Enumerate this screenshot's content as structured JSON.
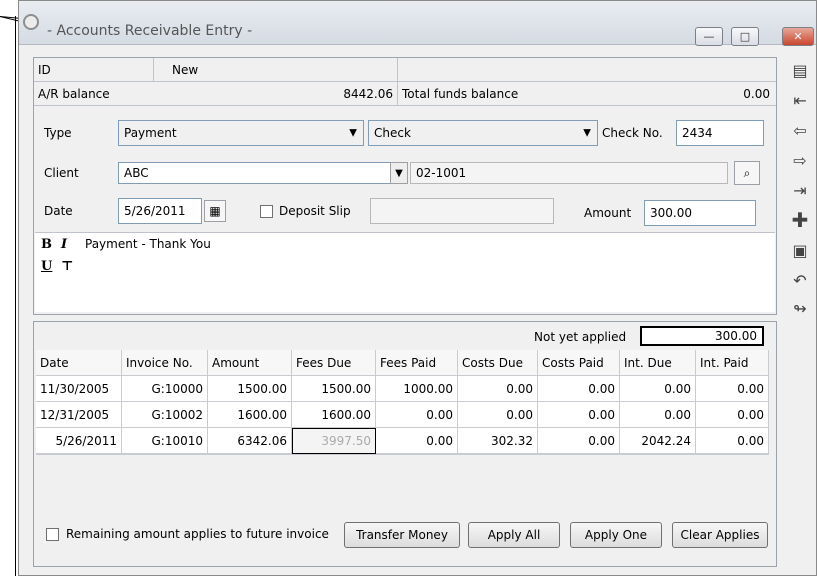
{
  "window": {
    "title": "- Accounts Receivable Entry -",
    "minimize_glyph": "—",
    "maximize_glyph": "□",
    "close_glyph": "✕"
  },
  "header": {
    "id_label": "ID",
    "id_value": "New",
    "ar_balance_label": "A/R balance",
    "ar_balance_value": "8442.06",
    "total_funds_label": "Total funds balance",
    "total_funds_value": "0.00"
  },
  "form": {
    "type_label": "Type",
    "type_value": "Payment",
    "method_value": "Check",
    "check_no_label": "Check No.",
    "check_no_value": "2434",
    "client_label": "Client",
    "client_value": "ABC",
    "client_code": "02-1001",
    "date_label": "Date",
    "date_value": "5/26/2011",
    "deposit_slip_label": "Deposit Slip",
    "deposit_slip_value": "",
    "amount_label": "Amount",
    "amount_value": "300.00",
    "memo": "Payment - Thank You"
  },
  "apply": {
    "not_yet_applied_label": "Not yet applied",
    "not_yet_applied_value": "300.00",
    "columns": [
      "Date",
      "Invoice No.",
      "Amount",
      "Fees Due",
      "Fees Paid",
      "Costs Due",
      "Costs Paid",
      "Int. Due",
      "Int. Paid"
    ],
    "rows": [
      [
        "11/30/2005",
        "G:10000",
        "1500.00",
        "1500.00",
        "1000.00",
        "0.00",
        "0.00",
        "0.00",
        "0.00"
      ],
      [
        "12/31/2005",
        "G:10002",
        "1600.00",
        "1600.00",
        "0.00",
        "0.00",
        "0.00",
        "0.00",
        "0.00"
      ],
      [
        "5/26/2011",
        "G:10010",
        "6342.06",
        "3997.50",
        "0.00",
        "302.32",
        "0.00",
        "2042.24",
        "0.00"
      ]
    ],
    "remaining_label": "Remaining amount applies to future invoice",
    "buttons": {
      "transfer": "Transfer Money",
      "apply_all": "Apply All",
      "apply_one": "Apply One",
      "clear": "Clear Applies"
    }
  },
  "toolbar_icons": [
    "document-icon",
    "first-record-icon",
    "previous-record-icon",
    "next-record-icon",
    "last-record-icon",
    "add-icon",
    "save-icon",
    "undo-icon",
    "exit-icon"
  ]
}
